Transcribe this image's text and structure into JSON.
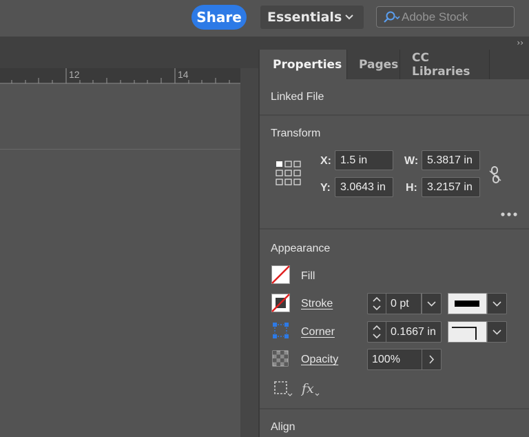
{
  "header": {
    "share_label": "Share",
    "workspace_label": "Essentials",
    "search_placeholder": "Adobe Stock"
  },
  "ruler": {
    "marks": [
      "12",
      "14"
    ]
  },
  "panel": {
    "tabs": [
      {
        "label": "Properties",
        "active": true
      },
      {
        "label": "Pages",
        "active": false
      },
      {
        "label": "CC Libraries",
        "active": false
      }
    ],
    "linked_file_title": "Linked File",
    "transform": {
      "title": "Transform",
      "x_label": "X:",
      "x_value": "1.5 in",
      "y_label": "Y:",
      "y_value": "3.0643 in",
      "w_label": "W:",
      "w_value": "5.3817 in",
      "h_label": "H:",
      "h_value": "3.2157 in"
    },
    "appearance": {
      "title": "Appearance",
      "fill_label": "Fill",
      "stroke_label": "Stroke",
      "stroke_weight": "0 pt",
      "corner_label": "Corner",
      "corner_value": "0.1667 in",
      "opacity_label": "Opacity",
      "opacity_value": "100%"
    },
    "align_title": "Align"
  },
  "colors": {
    "accent": "#2d7ae6",
    "fill_none_slash": "#e02020",
    "panel_bg": "#535353",
    "field_bg": "#3b3b3b"
  },
  "icons": [
    "search-icon",
    "chevron-down-icon",
    "reference-point-icon",
    "constrain-proportions-icon",
    "more-options-icon",
    "fill-swatch-icon",
    "stroke-swatch-icon",
    "corner-icon",
    "opacity-icon",
    "frame-fitting-icon",
    "effects-icon"
  ]
}
